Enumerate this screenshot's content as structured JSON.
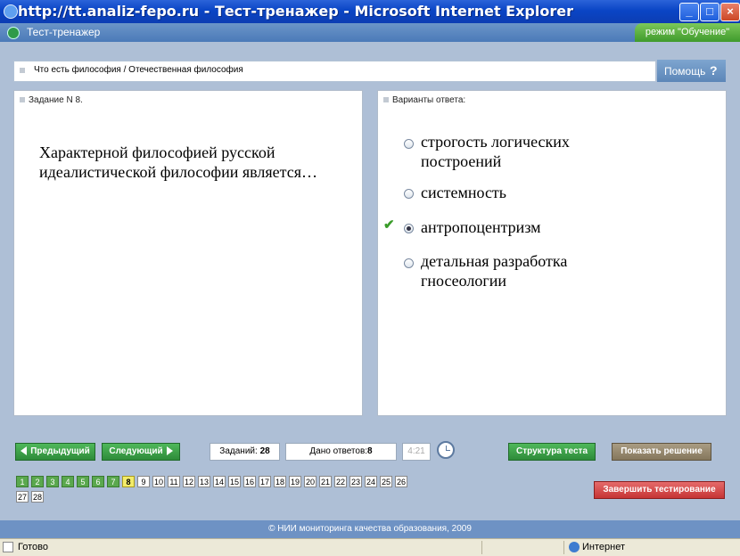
{
  "window": {
    "title": "http://tt.analiz-fepo.ru - Тест-тренажер - Microsoft Internet Explorer",
    "minimize": "_",
    "maximize": "□",
    "close": "×"
  },
  "app": {
    "name": "Тест-тренажер",
    "mode": "режим \"Обучение\""
  },
  "breadcrumb": "Что есть философия / Отечественная философия",
  "help": {
    "label": "Помощь",
    "icon": "?"
  },
  "task": {
    "header": "Задание N 8.",
    "question": "Характерной философией русской идеалистической философии является…"
  },
  "answers": {
    "header": "Варианты ответа:",
    "selected_index": 2,
    "options": [
      {
        "text": "строгость логических построений"
      },
      {
        "text": "системность"
      },
      {
        "text": "антропоцентризм"
      },
      {
        "text": "детальная разработка гносеологии"
      }
    ]
  },
  "controls": {
    "prev": "Предыдущий",
    "next": "Следующий",
    "tasks_label": "Заданий:",
    "tasks_count": "28",
    "answered_label": "Дано ответов:",
    "answered_count": "8",
    "timer": "4:21",
    "structure": "Структура теста",
    "show_solution": "Показать решение",
    "finish": "Завершить тестирование"
  },
  "pager": {
    "numbers": [
      "1",
      "2",
      "3",
      "4",
      "5",
      "6",
      "7",
      "8",
      "9",
      "10",
      "11",
      "12",
      "13",
      "14",
      "15",
      "16",
      "17",
      "18",
      "19",
      "20",
      "21",
      "22",
      "23",
      "24",
      "25",
      "26",
      "27",
      "28"
    ],
    "done_until": 7,
    "current": 8
  },
  "footer": "© НИИ мониторинга качества образования, 2009",
  "status": {
    "ready": "Готово",
    "zone": "Интернет"
  },
  "colors": {
    "done": "#5aa84e",
    "current": "#f3ec6a",
    "titlebar": "#0a45c5"
  }
}
